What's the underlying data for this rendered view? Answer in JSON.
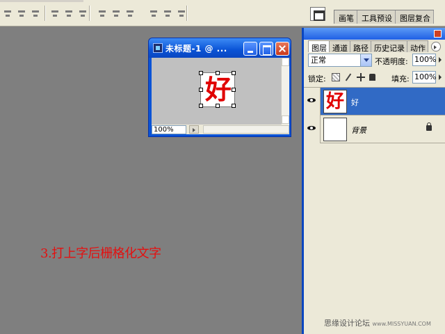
{
  "options_bar": {
    "dock_tabs": [
      "画笔",
      "工具预设",
      "图层复合"
    ]
  },
  "document": {
    "title": "未标题-1 @ ...",
    "glyph": "好",
    "zoom": "100%"
  },
  "layers_panel": {
    "tabs": [
      "图层",
      "通道",
      "路径",
      "历史记录",
      "动作"
    ],
    "blend_mode": "正常",
    "opacity_label": "不透明度:",
    "opacity_value": "100%",
    "lock_label": "锁定:",
    "fill_label": "填充:",
    "fill_value": "100%",
    "layers": [
      {
        "name": "好",
        "thumb": "好",
        "selected": true,
        "visible": true
      },
      {
        "name": "背景",
        "thumb": "",
        "selected": false,
        "visible": true,
        "locked": true
      }
    ]
  },
  "caption": "3.打上字后栅格化文字",
  "watermark": {
    "text": "思缘设计论坛",
    "url": "www.MISSYUAN.COM"
  },
  "colors": {
    "caption_red": "#e41010",
    "glyph_red": "#e00000",
    "selection_blue": "#316ac5",
    "titlebar_blue": "#0a53d6"
  }
}
